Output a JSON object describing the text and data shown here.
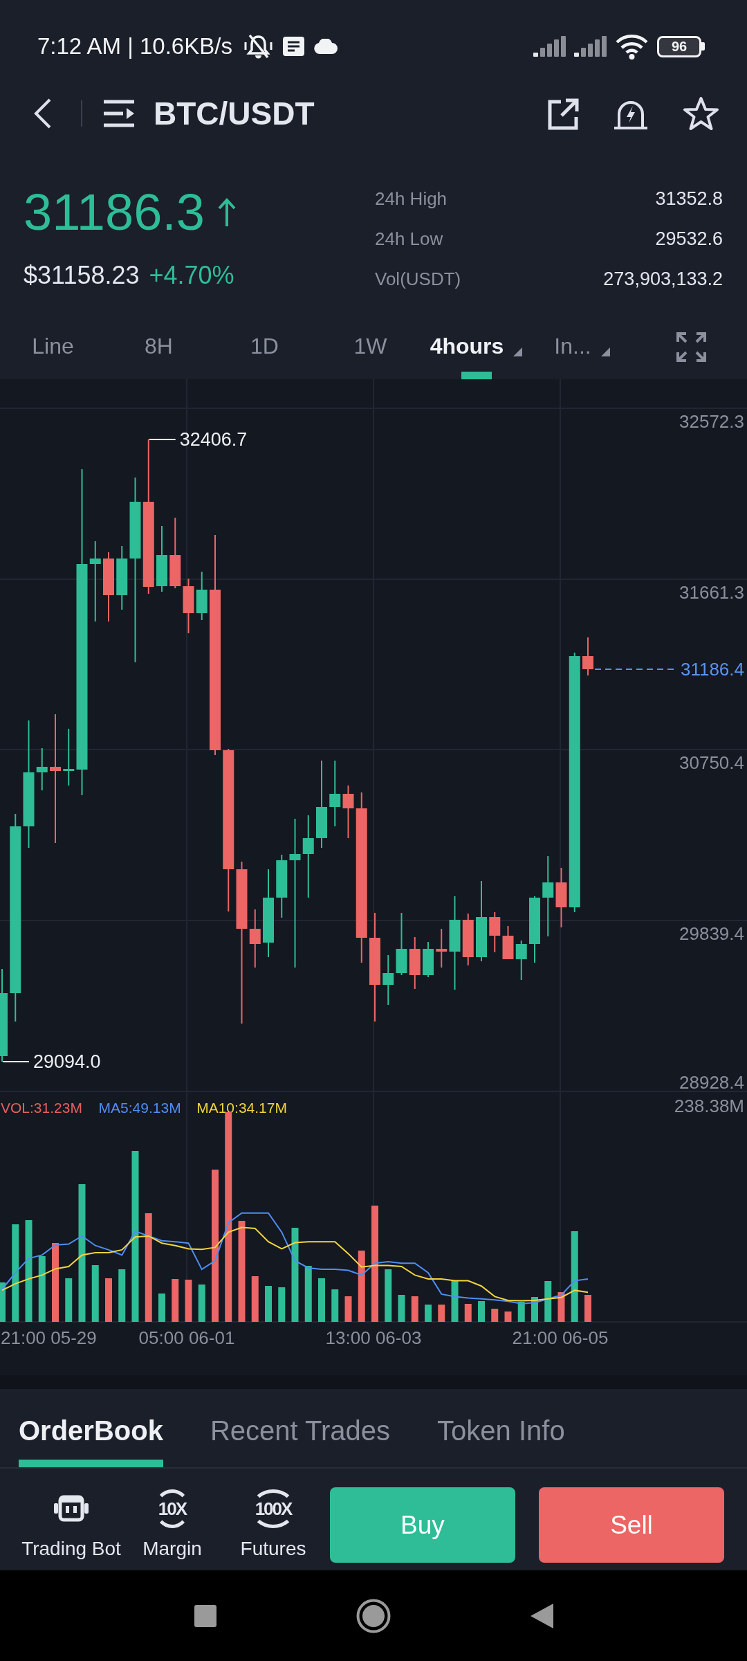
{
  "status_bar": {
    "text": "7:12 AM | 10.6KB/s",
    "battery": "96"
  },
  "header": {
    "title": "BTC/USDT",
    "favorite": false
  },
  "price": {
    "last": "31186.3",
    "rising": true,
    "fiat": "$31158.23",
    "change": "+4.70%"
  },
  "stats": [
    {
      "label": "24h High",
      "value": "31352.8"
    },
    {
      "label": "24h Low",
      "value": "29532.6"
    },
    {
      "label": "Vol(USDT)",
      "value": "273,903,133.2"
    }
  ],
  "intervals": [
    {
      "label": "Line",
      "selected": false,
      "dropdown": false
    },
    {
      "label": "8H",
      "selected": false,
      "dropdown": false
    },
    {
      "label": "1D",
      "selected": false,
      "dropdown": false
    },
    {
      "label": "1W",
      "selected": false,
      "dropdown": false
    },
    {
      "label": "4hours",
      "selected": true,
      "dropdown": true
    },
    {
      "label": "In...",
      "selected": false,
      "dropdown": true
    }
  ],
  "chart": {
    "price_axis": [
      "32572.3",
      "31661.3",
      "30750.4",
      "29839.4",
      "28928.4"
    ],
    "high_label": "32406.7",
    "low_label": "29094.0",
    "last_price": "31186.4",
    "volume_legend": [
      {
        "kind": "vol",
        "text": "VOL:31.23M",
        "color": "#e5605e"
      },
      {
        "kind": "ma5",
        "text": "MA5:49.13M",
        "color": "#4f8ef2"
      },
      {
        "kind": "ma10",
        "text": "MA10:34.17M",
        "color": "#f2d53c"
      }
    ],
    "volume_axis": "238.38M",
    "time_axis": [
      "21:00 05-29",
      "05:00 06-01",
      "13:00 06-03",
      "21:00 06-05"
    ]
  },
  "bottom_tabs": [
    {
      "label": "OrderBook",
      "selected": true
    },
    {
      "label": "Recent Trades",
      "selected": false
    },
    {
      "label": "Token Info",
      "selected": false
    }
  ],
  "actions": [
    {
      "kind": "bot",
      "label": "Trading Bot"
    },
    {
      "kind": "leverage",
      "badge": "10X",
      "label": "Margin"
    },
    {
      "kind": "leverage",
      "badge": "100X",
      "label": "Futures"
    }
  ],
  "trade_buttons": [
    {
      "kind": "buy",
      "label": "Buy"
    },
    {
      "kind": "sell",
      "label": "Sell"
    }
  ]
}
